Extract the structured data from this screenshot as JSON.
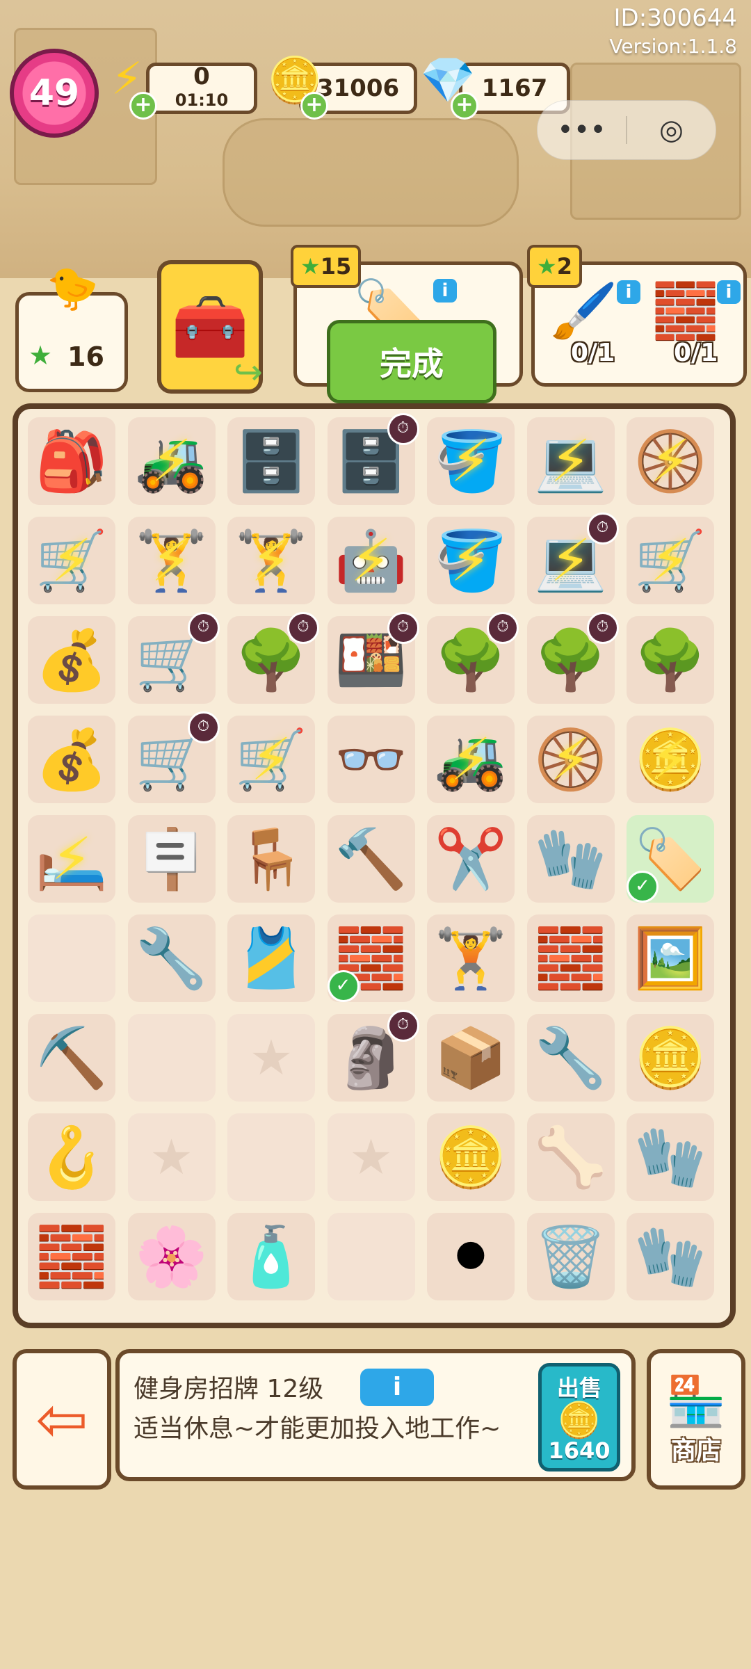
{
  "hud": {
    "level": "49",
    "id_text": "ID:300644",
    "version_text": "Version:1.1.8",
    "energy": {
      "value": "0",
      "timer": "01:10",
      "icon": "lightning-icon"
    },
    "coins": {
      "value": "31006",
      "icon": "coin-icon"
    },
    "gems": {
      "value": "1167",
      "icon": "gem-icon"
    },
    "miniapp": {
      "more_icon": "•••",
      "close_icon": "◎"
    }
  },
  "orders": {
    "worker_stars": "16",
    "order1": {
      "stars": "15",
      "status": "完成",
      "item": "gym-sign"
    },
    "order2": {
      "stars": "2",
      "items": [
        {
          "name": "paint-roller",
          "progress": "0/1"
        },
        {
          "name": "brick-pallet",
          "progress": "0/1"
        }
      ]
    }
  },
  "board": {
    "rows": [
      [
        "🎒",
        "🚜",
        "🗄️",
        "🗄️",
        "🪣",
        "💻",
        "🛞"
      ],
      [
        "🛒",
        "🏋️",
        "🏋️",
        "🤖",
        "🪣",
        "💻",
        "🛒"
      ],
      [
        "💰",
        "🛒",
        "🌳",
        "🍱",
        "🌳",
        "🌳",
        "🌳"
      ],
      [
        "💰",
        "🛒",
        "🛒",
        "👓",
        "🚜",
        "🛞",
        "🪙"
      ],
      [
        "🛏️",
        "🪧",
        "🪑",
        "🔨",
        "✂️",
        "🧤",
        "🏷️"
      ],
      [
        "",
        "🔧",
        "🎽",
        "🧱",
        "🏋️",
        "🧱",
        "🖼️"
      ],
      [
        "⛏️",
        "",
        "⭐",
        "🗿",
        "📦",
        "🔧",
        "🪙"
      ],
      [
        "🪝",
        "⭐",
        "",
        "⭐",
        "🪙",
        "🦴",
        "🧤"
      ],
      [
        "🧱",
        "🌸",
        "🧴",
        "",
        "⚫",
        "🗑️",
        "🧤"
      ]
    ]
  },
  "info_panel": {
    "item_name": "健身房招牌 12级",
    "info_label": "i",
    "description": "适当休息~才能更加投入地工作~",
    "sell_label": "出售",
    "sell_price": "1640",
    "shop_label": "商店"
  },
  "colors": {
    "accent_green": "#7ac943",
    "border_brown": "#6b4a2a",
    "energy_mark": "#ffe23a"
  }
}
